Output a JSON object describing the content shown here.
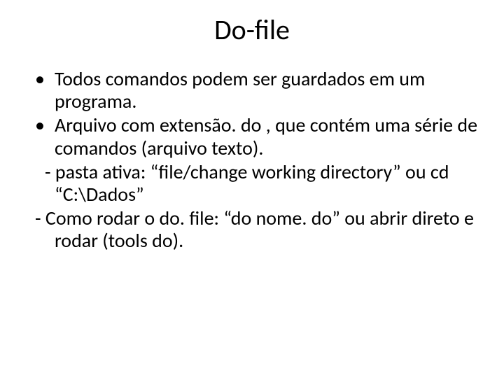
{
  "slide": {
    "title": "Do-file",
    "bullets": [
      "Todos comandos podem ser guardados em um programa.",
      "Arquivo com extensão. do , que contém uma série de comandos (arquivo texto)."
    ],
    "dash1": " - pasta ativa: “file/change working directory” ou cd “C:\\Dados”",
    "dash2": "- Como rodar o do. file: “do nome. do” ou abrir direto e rodar (tools do)."
  }
}
